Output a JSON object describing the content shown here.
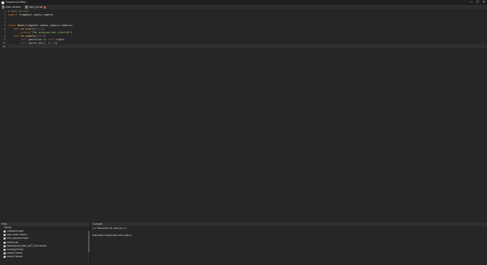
{
  "window": {
    "title": "Fragment Editor",
    "controls": {
      "minimize": "—",
      "maximize": "☐",
      "close": "✕"
    }
  },
  "tabs": [
    {
      "label": "main.fscene",
      "active": true,
      "modified": false
    },
    {
      "label": "cam_script",
      "active": false,
      "modified": true
    }
  ],
  "editor": {
    "line_numbers": [
      "1",
      "2",
      "3",
      "4",
      "5",
      "6",
      "7",
      "8",
      "9",
      "10",
      "11"
    ],
    "current_line": 11,
    "code": [
      [
        {
          "t": "# Node Script",
          "c": "comment"
        }
      ],
      [
        {
          "t": "import ",
          "c": "kw"
        },
        {
          "t": "fragment.nodes.camera",
          "c": "plain"
        }
      ],
      [],
      [],
      [
        {
          "t": "class ",
          "c": "kw"
        },
        {
          "t": "Node",
          "c": "cls"
        },
        {
          "t": "(fragment.nodes.camera.Camera):",
          "c": "plain"
        }
      ],
      [
        {
          "t": "    "
        },
        {
          "t": "def ",
          "c": "kw"
        },
        {
          "t": "on_start",
          "c": "fn"
        },
        {
          "t": "(",
          "c": "plain"
        },
        {
          "t": "self",
          "c": "self"
        },
        {
          "t": "):",
          "c": "plain"
        }
      ],
      [
        {
          "t": "        "
        },
        {
          "t": "print",
          "c": "kw"
        },
        {
          "t": "(",
          "c": "plain"
        },
        {
          "t": "\"The program has started\"",
          "c": "str"
        },
        {
          "t": ")",
          "c": "plain"
        }
      ],
      [
        {
          "t": "    "
        },
        {
          "t": "def ",
          "c": "kw"
        },
        {
          "t": "on_update",
          "c": "fn"
        },
        {
          "t": "(",
          "c": "plain"
        },
        {
          "t": "self",
          "c": "self"
        },
        {
          "t": "):",
          "c": "plain"
        }
      ],
      [
        {
          "t": "        "
        },
        {
          "t": "self",
          "c": "self"
        },
        {
          "t": ".position += ",
          "c": "plain"
        },
        {
          "t": "self",
          "c": "self"
        },
        {
          "t": ".right",
          "c": "plain"
        }
      ],
      [
        {
          "t": "        "
        },
        {
          "t": "self",
          "c": "self"
        },
        {
          "t": ".point_at(",
          "c": "plain"
        },
        {
          "t": "0",
          "c": "num"
        },
        {
          "t": ", ",
          "c": "plain"
        },
        {
          "t": "0",
          "c": "num"
        },
        {
          "t": ", ",
          "c": "plain"
        },
        {
          "t": "45",
          "c": "num"
        },
        {
          "t": ")",
          "c": "plain"
        }
      ],
      []
    ]
  },
  "files_panel": {
    "title": "Files",
    "column_header": "Name",
    "items": [
      "untitled.fmesh",
      "test_mesh.fmesh",
      "test_sponza.fmesh",
      "sinatra.py",
      "NewSponza_Main_glTF_003.fmesh",
      "monkey.fmesh",
      "mesh2.fmesh",
      "mesh1.fmesh"
    ]
  },
  "console_panel": {
    "title": "Console",
    "lines": [
      ">> Execution of: main.py <<",
      "",
      "Execution ended with exit code 0"
    ]
  },
  "colors": {
    "background": "#262626",
    "titlebar": "#1e1e1e",
    "modified_badge": "#e04f3f"
  }
}
